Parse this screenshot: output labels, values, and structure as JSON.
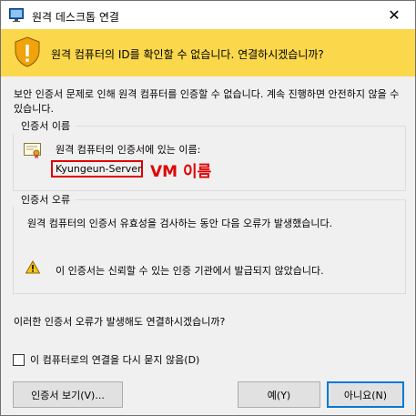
{
  "window": {
    "title": "원격 데스크톱 연결",
    "close_glyph": "✕"
  },
  "banner": {
    "message": "원격 컴퓨터의 ID를 확인할 수 없습니다. 연결하시겠습니까?",
    "color": "#fbd84b"
  },
  "intro": {
    "text": "보안 인증서 문제로 인해 원격 컴퓨터를 인증할 수 없습니다. 계속 진행하면 안전하지 않을 수 있습니다."
  },
  "cert_name_group": {
    "title": "인증서 이름",
    "label": "원격 컴퓨터의 인증서에 있는 이름:",
    "name_value": "Kyungeun-Server",
    "annotation": "VM 이름",
    "annotation_color": "#e00000"
  },
  "cert_error_group": {
    "title": "인증서 오류",
    "description": "원격 컴퓨터의 인증서 유효성을 검사하는 동안 다음 오류가 발생했습니다.",
    "warning": "이 인증서는 신뢰할 수 있는 인증 기관에서 발급되지 않았습니다."
  },
  "question": "이러한 인증서 오류가 발생해도 연결하시겠습니까?",
  "checkbox": {
    "label": "이 컴퓨터로의 연결을 다시 묻지 않음(D)",
    "checked": false
  },
  "buttons": {
    "view_cert": "인증서 보기(V)...",
    "yes": "예(Y)",
    "no": "아니요(N)"
  },
  "icons": {
    "app": "remote-desktop-icon",
    "shield": "warning-shield-icon",
    "cert": "certificate-icon",
    "warning": "warning-triangle-icon"
  }
}
